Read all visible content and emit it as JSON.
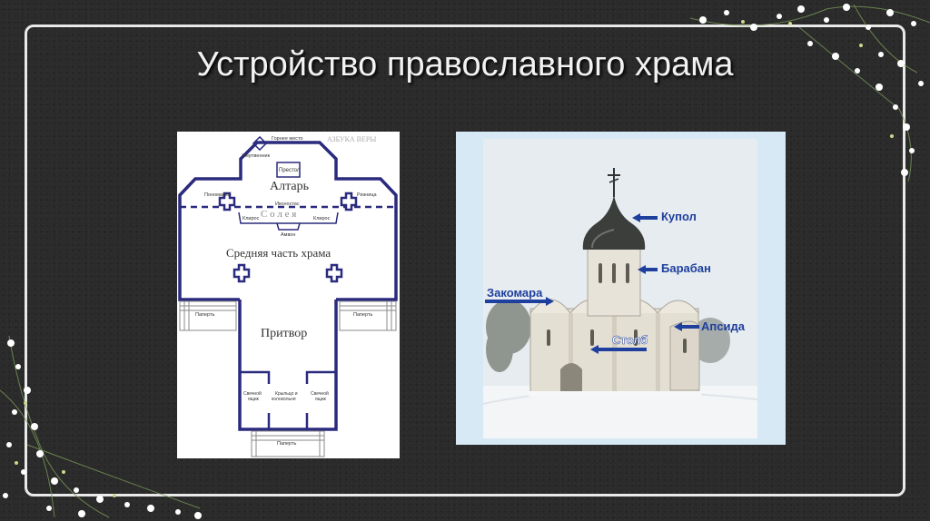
{
  "slide": {
    "title": "Устройство православного храма"
  },
  "plan": {
    "watermark": "АЗБУКА ВЕРЫ",
    "labels": {
      "gornee_mesto": "Горнее место",
      "zhertvennik": "Жертвенник",
      "prestol": "Престол",
      "altar": "Алтарь",
      "ponomarka": "Пономарка",
      "riznitsa": "Ризница",
      "ikonostas": "Иконостас",
      "soleya": "С о л е я",
      "kliros_left": "Клирос",
      "kliros_right": "Клирос",
      "amvon": "Амвон",
      "middle": "Средняя часть храма",
      "paperti_left": "Паперть",
      "paperti_right": "Паперть",
      "pritvor": "Притвор",
      "svechnoy_left": [
        "Свечной",
        "ящик"
      ],
      "krylco": [
        "Крыльцо и",
        "колокольня"
      ],
      "svechnoy_right": [
        "Свечной",
        "ящик"
      ],
      "paperti_bottom": "Паперть"
    },
    "colors": {
      "wall": "#2a2a7e",
      "text": "#333333"
    }
  },
  "photo": {
    "labels": {
      "kupol": "Купол",
      "baraban": "Барабан",
      "zakomara": "Закомара",
      "apsida": "Апсида",
      "stolb": "Столб"
    },
    "colors": {
      "arrow": "#1f3f9f",
      "sky": "#e8eef2",
      "snow": "#f4f6f8"
    }
  }
}
